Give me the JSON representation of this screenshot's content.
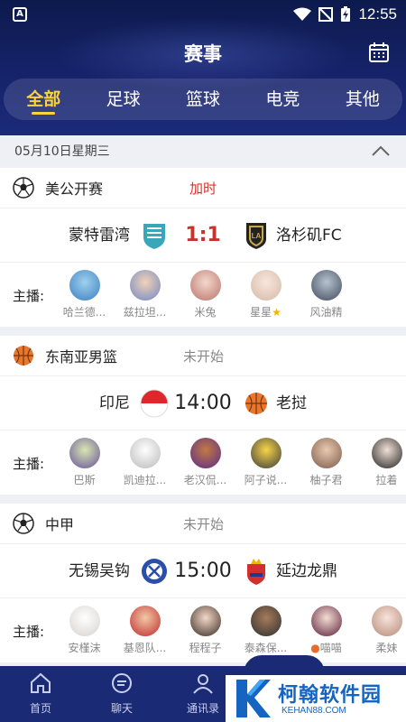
{
  "status_bar": {
    "time": "12:55",
    "app_badge": "A"
  },
  "header": {
    "title": "赛事"
  },
  "tabs": [
    {
      "label": "全部",
      "active": true
    },
    {
      "label": "足球",
      "active": false
    },
    {
      "label": "篮球",
      "active": false
    },
    {
      "label": "电竞",
      "active": false
    },
    {
      "label": "其他",
      "active": false
    }
  ],
  "date_header": "05月10日星期三",
  "matches": [
    {
      "league": "美公开赛",
      "league_icon": "soccer-ball-icon",
      "status": "加时",
      "home": "蒙特雷湾",
      "away": "洛杉矶FC",
      "score": "1:1",
      "anchor_label": "主播:",
      "anchors": [
        "哈兰德...",
        "兹拉坦...",
        "米兔",
        "星星",
        "风油精"
      ]
    },
    {
      "league": "东南亚男篮",
      "league_icon": "basketball-icon",
      "status": "未开始",
      "home": "印尼",
      "away": "老挝",
      "score": "14:00",
      "anchor_label": "主播:",
      "anchors": [
        "巴斯",
        "凯迪拉...",
        "老汉侃...",
        "阿子说...",
        "柚子君",
        "拉着"
      ]
    },
    {
      "league": "中甲",
      "league_icon": "soccer-ball-icon",
      "status": "未开始",
      "home": "无锡吴钩",
      "away": "延边龙鼎",
      "score": "15:00",
      "anchor_label": "主播:",
      "anchors": [
        "安槿沫",
        "基恩队...",
        "程程子",
        "泰森保...",
        "喵喵",
        "柔妹"
      ]
    }
  ],
  "bottom_nav": [
    {
      "label": "首页",
      "icon": "home-icon"
    },
    {
      "label": "聊天",
      "icon": "chat-icon"
    },
    {
      "label": "通讯录",
      "icon": "contacts-icon"
    }
  ],
  "watermark": {
    "text": "柯翰软件园",
    "sub": "KEHAN88.COM"
  },
  "colors": {
    "header_bg": "#16236a",
    "accent": "#ffd23c",
    "live": "#e0302a",
    "nav_bg": "#1b2a74"
  }
}
